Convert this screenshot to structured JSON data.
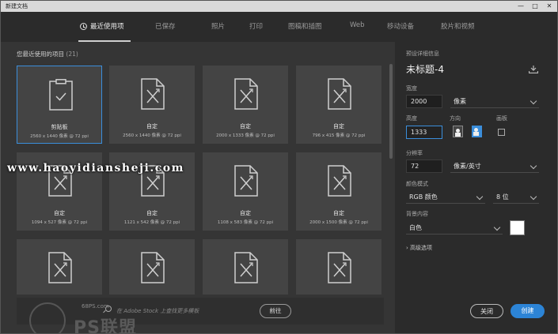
{
  "window": {
    "title": "新建文档",
    "controls": [
      "—",
      "□",
      "✕"
    ]
  },
  "tabs": [
    {
      "label": "最近使用项",
      "active": true
    },
    {
      "label": "已保存"
    },
    {
      "label": "照片"
    },
    {
      "label": "打印"
    },
    {
      "label": "图稿和插图"
    },
    {
      "label": "Web"
    },
    {
      "label": "移动设备"
    },
    {
      "label": "胶片和视频"
    }
  ],
  "recent": {
    "label": "您最近使用的项目",
    "count": "(21)"
  },
  "cards": [
    {
      "name": "剪贴板",
      "sub": "2560 x 1440 像素 @ 72 ppi",
      "icon": "clipboard-icon",
      "selected": true
    },
    {
      "name": "自定",
      "sub": "2560 x 1440 像素 @ 72 ppi",
      "icon": "document-icon"
    },
    {
      "name": "自定",
      "sub": "2000 x 1333 像素 @ 72 ppi",
      "icon": "document-icon"
    },
    {
      "name": "自定",
      "sub": "796 x 415 像素 @ 72 ppi",
      "icon": "document-icon"
    },
    {
      "name": "自定",
      "sub": "1094 x 527 像素 @ 72 ppi",
      "icon": "document-icon"
    },
    {
      "name": "自定",
      "sub": "1121 x 542 像素 @ 72 ppi",
      "icon": "document-icon"
    },
    {
      "name": "自定",
      "sub": "1108 x 583 像素 @ 72 ppi",
      "icon": "document-icon"
    },
    {
      "name": "自定",
      "sub": "2000 x 1500 像素 @ 72 ppi",
      "icon": "document-icon"
    },
    {
      "name": "",
      "sub": "",
      "icon": "document-icon"
    },
    {
      "name": "",
      "sub": "",
      "icon": "document-icon"
    },
    {
      "name": "",
      "sub": "",
      "icon": "document-icon"
    },
    {
      "name": "",
      "sub": "",
      "icon": "document-icon"
    }
  ],
  "search": {
    "placeholder": "在 Adobe Stock 上查找更多模板",
    "button": "前往"
  },
  "preset": {
    "header": "预设详细信息",
    "title": "未标题-4",
    "width_label": "宽度",
    "width_value": "2000",
    "width_unit": "像素",
    "height_label": "高度",
    "height_value": "1333",
    "orientation_label": "方向",
    "artboard_label": "画板",
    "resolution_label": "分辨率",
    "resolution_value": "72",
    "resolution_unit": "像素/英寸",
    "color_mode_label": "颜色模式",
    "color_mode_value": "RGB 颜色",
    "bit_depth_value": "8 位",
    "background_label": "背景内容",
    "background_value": "白色",
    "advanced_label": "高级选项"
  },
  "buttons": {
    "close": "关闭",
    "create": "创建"
  },
  "watermark": {
    "url": "www.haoyidiansheji.com",
    "site": "68PS.com",
    "brand": "PS联盟"
  },
  "colors": {
    "accent": "#2c84d6",
    "selection": "#3b8edb",
    "background_swatch": "#ffffff"
  }
}
